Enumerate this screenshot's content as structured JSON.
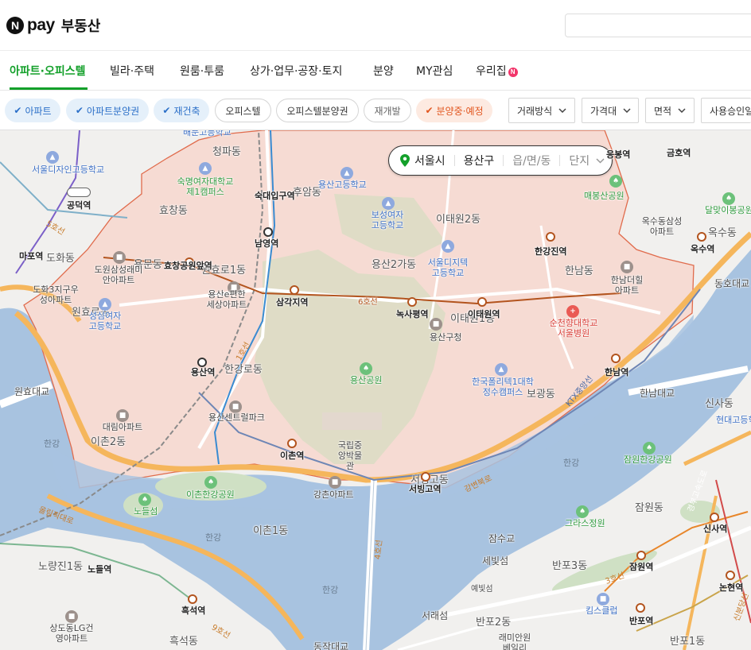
{
  "header": {
    "brand_n": "N",
    "brand_pay": "pay",
    "brand_title": "부동산",
    "search_value": ""
  },
  "nav": {
    "tabs": [
      {
        "label": "아파트·오피스텔",
        "active": true
      },
      {
        "label": "빌라·주택"
      },
      {
        "label": "원룸·투룸"
      },
      {
        "label": "상가·업무·공장·토지"
      },
      {
        "label": "분양"
      },
      {
        "label": "MY관심"
      },
      {
        "label": "우리집"
      }
    ],
    "new_badge": "N"
  },
  "filters": {
    "check": "✔",
    "chips": [
      {
        "label": "아파트",
        "state": "selected"
      },
      {
        "label": "아파트분양권",
        "state": "selected"
      },
      {
        "label": "재건축",
        "state": "selected"
      },
      {
        "label": "오피스텔",
        "state": "unselected"
      },
      {
        "label": "오피스텔분양권",
        "state": "unselected"
      },
      {
        "label": "재개발",
        "state": "unselected"
      },
      {
        "label": "분양중·예정",
        "state": "highlighted"
      }
    ],
    "dropdowns": [
      "거래방식",
      "가격대",
      "면적",
      "사용승인일"
    ]
  },
  "location": {
    "city": "서울시",
    "district": "용산구",
    "dong": "읍/면/동",
    "complex": "단지"
  },
  "map": {
    "colors": {
      "river": "#a8c3e0",
      "district_fill": "#f6dbd3",
      "district_border": "#e06b4c",
      "park": "#cfe0c4",
      "road_orange": "#f5b65c",
      "line6": "#b3541e"
    },
    "areas": [
      "청파동",
      "효창동",
      "용문동",
      "원효로1동",
      "원효로동",
      "도화동",
      "한강로동",
      "이촌2동",
      "이촌1동",
      "용산2가동",
      "이태원2동",
      "한남동",
      "보광동",
      "서빙고동",
      "이태원1동",
      "반포3동",
      "반포2동",
      "반포1동",
      "잠원동",
      "흑석동",
      "노량진1동",
      "신사동",
      "옥수동",
      "후암동"
    ],
    "stations": [
      "공덕역",
      "마포역",
      "효창공원앞역",
      "숙대입구역",
      "남영역",
      "삼각지역",
      "녹사평역",
      "이태원역",
      "한강진역",
      "한남역",
      "용산역",
      "이촌역",
      "서빙고역",
      "신사역",
      "잠원역",
      "반포역",
      "흑석역",
      "노들역",
      "옥수역",
      "논현역",
      "금호역",
      "응봉역"
    ],
    "pois": [
      "서울디자인고등학교",
      "숙명여자대학교제1캠퍼스",
      "배문고등학교",
      "용산고등학교",
      "보성여자고등학교",
      "매봉산공원",
      "서울디지텍고등학교",
      "한남더힐아파트",
      "순천향대학교서울병원",
      "성심여자고등학교",
      "용산구청",
      "용산공원",
      "한국폴리텍1대학정수캠퍼스",
      "국립중앙박물관",
      "이촌한강공원",
      "노들섬",
      "잠원한강공원",
      "그라스정원",
      "킴스클럽",
      "달맞이봉공원",
      "현대고등학교",
      "옥수동삼성아파트",
      "대림아파트",
      "용산센트럴파크",
      "강촌아파트",
      "도원삼성래미안아파트",
      "도화3지구우성아파트",
      "용산e편한세상아파트",
      "상도동LG건영아파트",
      "래미안원베일리"
    ],
    "waters": [
      "한강",
      "한강",
      "한강",
      "한강"
    ],
    "roads": [
      "강변북로",
      "올림픽대로",
      "원효대교",
      "한남대교",
      "잠수교",
      "동작대교",
      "동호대교",
      "세빛섬",
      "서래섬",
      "예빛섬",
      "4호선",
      "6호선",
      "3호선",
      "9호선",
      "KTX중앙선",
      "신분당선",
      "경부고속도로",
      "5호선",
      "1호선"
    ]
  }
}
